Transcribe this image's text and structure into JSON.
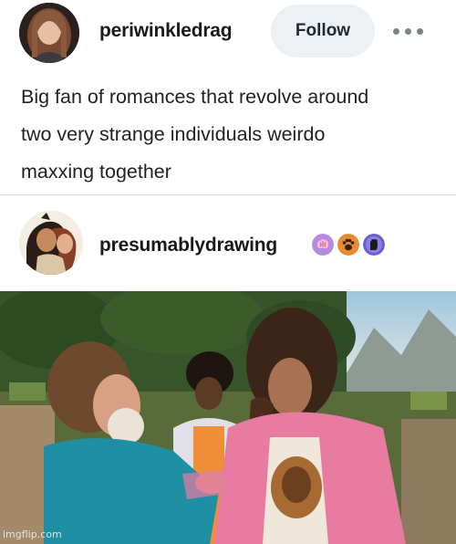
{
  "post": {
    "username": "periwinkledrag",
    "follow_label": "Follow",
    "text_lines": [
      "Big fan of romances that revolve around",
      "two very strange individuals weirdo",
      "maxxing together"
    ]
  },
  "reblog": {
    "username": "presumablydrawing",
    "badges": [
      "brain-badge-icon",
      "paw-badge-icon",
      "glove-badge-icon"
    ]
  },
  "image": {
    "watermark": "imgflip.com"
  },
  "colors": {
    "follow_bg": "#eef1f3",
    "text": "#222222",
    "divider": "#dcdcdc"
  }
}
